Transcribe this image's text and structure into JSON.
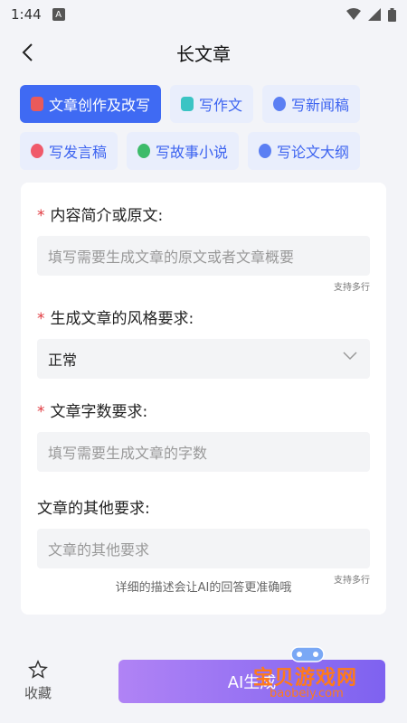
{
  "status_bar": {
    "time": "1:44",
    "notification_glyph": "A"
  },
  "header": {
    "title": "长文章"
  },
  "tabs": [
    {
      "label": "文章创作及改写",
      "icon": "file-edit-icon",
      "icon_color": "#e95a5a",
      "active": true
    },
    {
      "label": "写作文",
      "icon": "note-icon",
      "icon_color": "#3bc4c4",
      "active": false
    },
    {
      "label": "写新闻稿",
      "icon": "news-icon",
      "icon_color": "#5b7ff3",
      "active": false
    },
    {
      "label": "写发言稿",
      "icon": "mic-icon",
      "icon_color": "#f05a6a",
      "active": false
    },
    {
      "label": "写故事小说",
      "icon": "book-icon",
      "icon_color": "#3dbb6a",
      "active": false
    },
    {
      "label": "写论文大纲",
      "icon": "doc-icon",
      "icon_color": "#5b7ff3",
      "active": false
    }
  ],
  "form": {
    "content": {
      "required_mark": "*",
      "label": "内容简介或原文:",
      "placeholder": "填写需要生成文章的原文或者文章概要",
      "hint": "支持多行"
    },
    "style": {
      "required_mark": "*",
      "label": "生成文章的风格要求:",
      "value": "正常"
    },
    "word_count": {
      "required_mark": "*",
      "label": "文章字数要求:",
      "placeholder": "填写需要生成文章的字数"
    },
    "other": {
      "label": "文章的其他要求:",
      "placeholder": "文章的其他要求",
      "hint": "支持多行"
    },
    "footer_note": "详细的描述会让AI的回答更准确哦"
  },
  "bottom": {
    "collect_label": "收藏",
    "generate_label": "AI生成"
  },
  "watermark": {
    "text": "宝贝游戏网",
    "url": "baobeiy.com"
  },
  "colors": {
    "accent": "#3f6af3",
    "chip_bg": "#e9eefc",
    "required": "#e0383e",
    "gradient_start": "#b083f5",
    "gradient_end": "#7e62f0"
  }
}
